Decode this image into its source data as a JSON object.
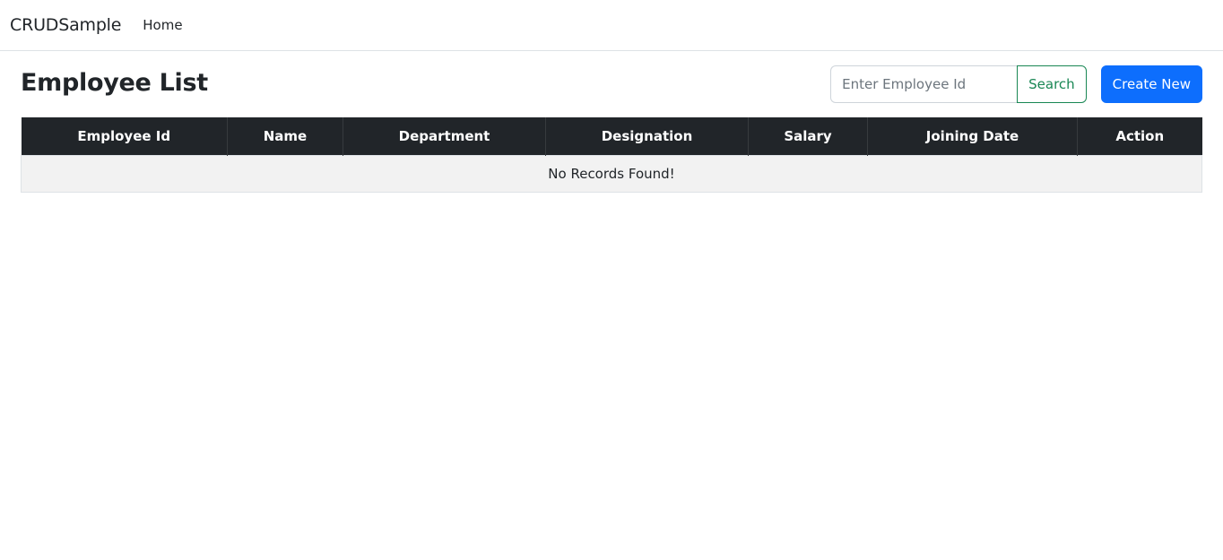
{
  "navbar": {
    "brand": "CRUDSample",
    "links": [
      {
        "label": "Home"
      }
    ]
  },
  "page": {
    "title": "Employee List"
  },
  "search": {
    "placeholder": "Enter Employee Id",
    "value": "",
    "button_label": "Search"
  },
  "actions": {
    "create_label": "Create New"
  },
  "colors": {
    "header_bg": "#212529",
    "primary": "#0d6efd",
    "success": "#198754",
    "empty_row_bg": "#f2f2f2"
  },
  "table": {
    "columns": [
      "Employee Id",
      "Name",
      "Department",
      "Designation",
      "Salary",
      "Joining Date",
      "Action"
    ],
    "rows": [],
    "empty_message": "No Records Found!"
  }
}
